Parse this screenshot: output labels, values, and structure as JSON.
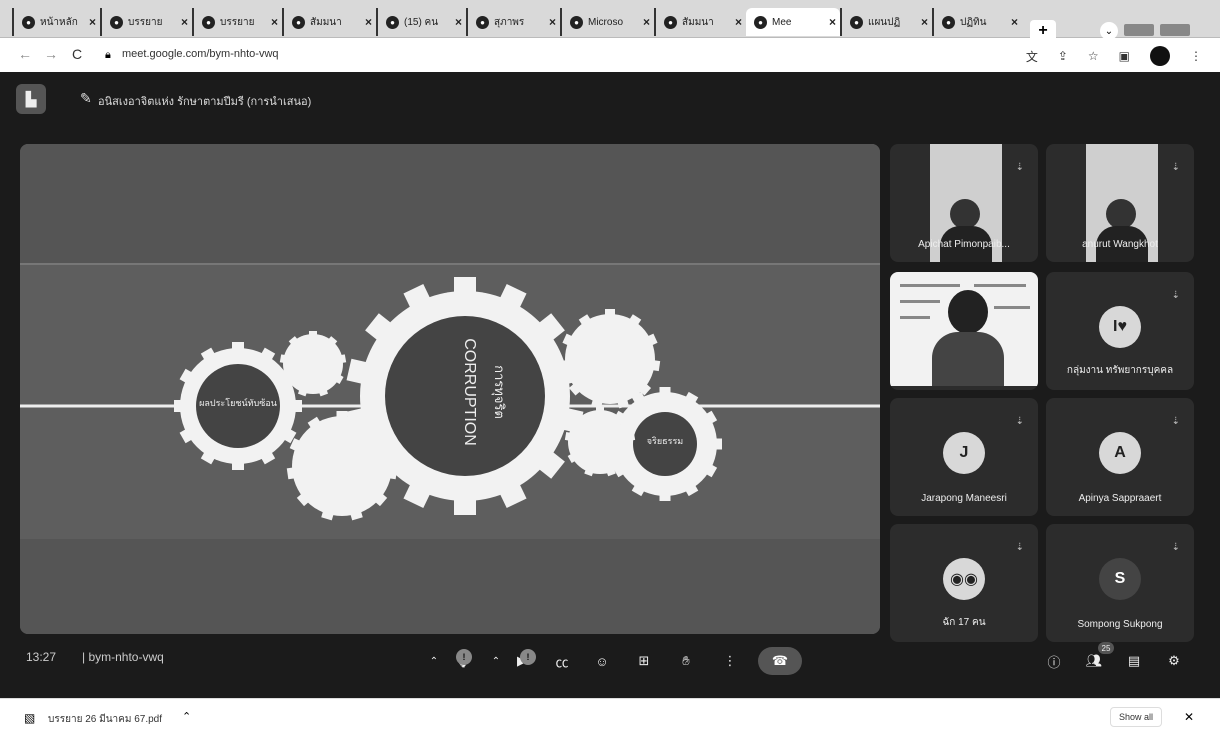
{
  "browser": {
    "tabs": [
      {
        "icon": "camera-icon",
        "label": "หน้าหลัก"
      },
      {
        "icon": "message-icon",
        "label": "บรรยาย"
      },
      {
        "icon": "globe-icon",
        "label": "บรรยาย"
      },
      {
        "icon": "google-icon",
        "label": "สัมมนา"
      },
      {
        "icon": "youtube-icon",
        "label": "(15) คน"
      },
      {
        "icon": "facebook-icon",
        "label": "สุภาพร"
      },
      {
        "icon": "globe-icon",
        "label": "Microso"
      },
      {
        "icon": "google-icon",
        "label": "สัมมนา"
      },
      {
        "icon": "meet-icon",
        "label": "Mee"
      },
      {
        "icon": "google-icon",
        "label": "แผนปฏิ"
      },
      {
        "icon": "calendar-icon",
        "label": "ปฏิทิน"
      }
    ],
    "url": "meet.google.com/bym-nhto-vwq"
  },
  "meet": {
    "presenter_label": "อนิสเงอาจิตแห่ง รักษาตามปีมรี (การนำเสนอ)",
    "participants": [
      {
        "name": "Apichat Pimonpaib...",
        "type": "video"
      },
      {
        "name": "anurut Wangkhot",
        "type": "video"
      },
      {
        "name": "",
        "type": "slide"
      },
      {
        "name": "กลุ่มงาน ทรัพยากรบุคคล",
        "type": "avatar",
        "initial": "I♥"
      },
      {
        "name": "Jarapong Maneesri",
        "type": "avatar",
        "initial": "J"
      },
      {
        "name": "Apinya Sappraaert",
        "type": "avatar",
        "initial": "A"
      },
      {
        "name": "ฉัก 17 คน",
        "type": "group",
        "initial": "◉◉"
      },
      {
        "name": "Sompong Sukpong",
        "type": "avatar",
        "initial": "S"
      }
    ],
    "time": "13:27",
    "meeting_code": "bym-nhto-vwq",
    "participant_count": "25",
    "slide": {
      "main_gear_text": "CORRUPTION",
      "main_gear_sub": "การทุจริต",
      "left_gear_text": "ผลประโยชน์ทับซ้อน",
      "right_gear_text": "จริยธรรม"
    }
  },
  "download": {
    "filename": "บรรยาย 26 มีนาคม 67.pdf",
    "show_all": "Show all"
  }
}
